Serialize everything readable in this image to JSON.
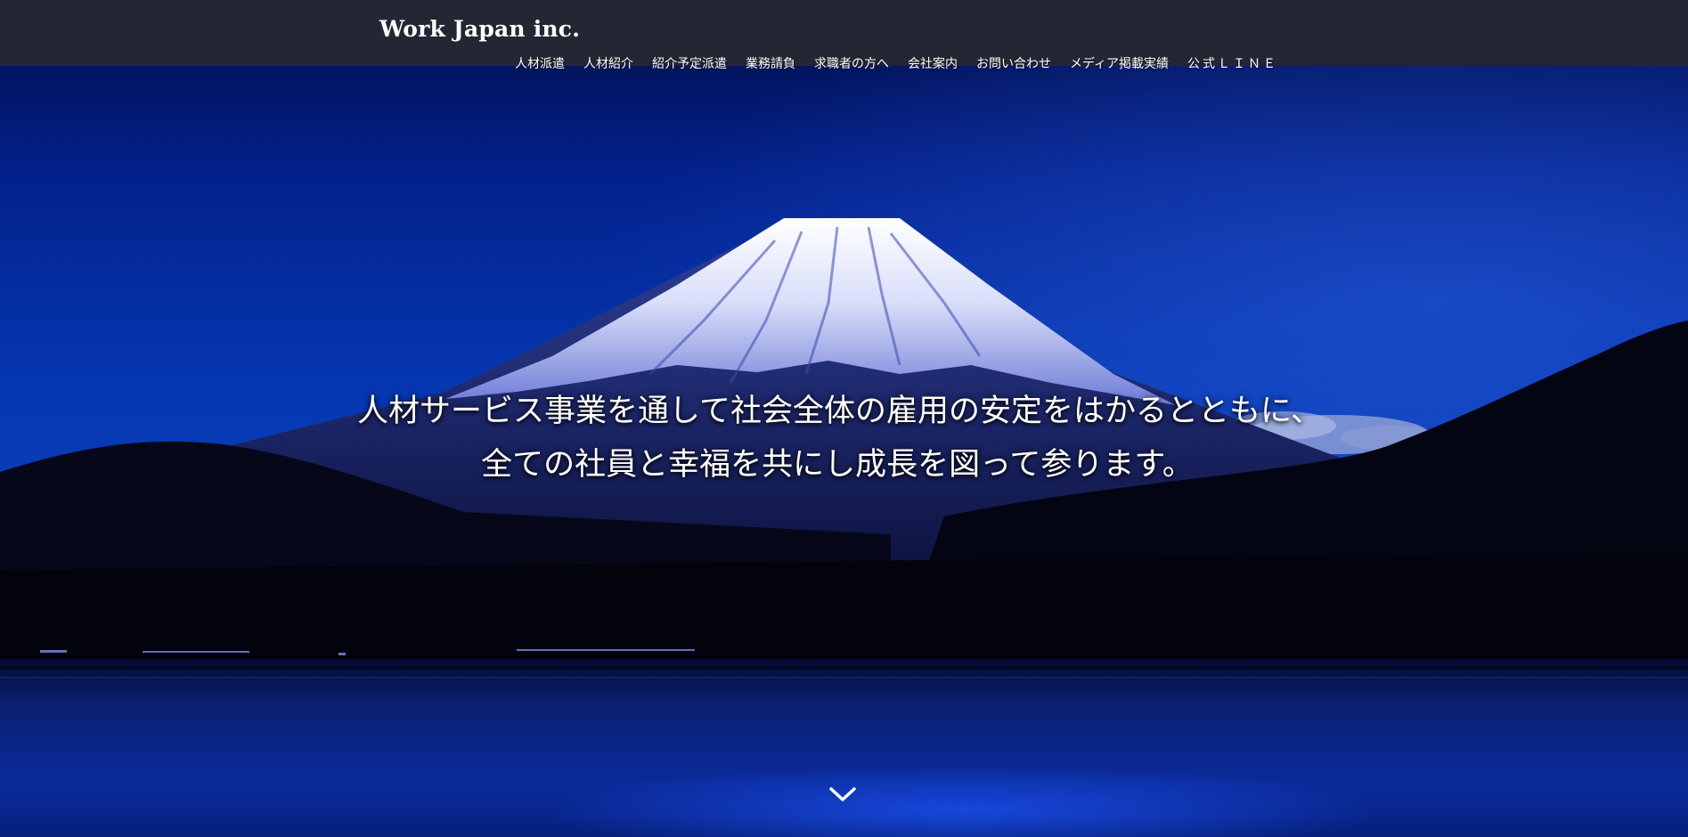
{
  "header": {
    "logo": "Work Japan inc."
  },
  "nav": {
    "items": [
      {
        "label": "人材派遣"
      },
      {
        "label": "人材紹介"
      },
      {
        "label": "紹介予定派遣"
      },
      {
        "label": "業務請負"
      },
      {
        "label": "求職者の方へ"
      },
      {
        "label": "会社案内"
      },
      {
        "label": "お問い合わせ"
      },
      {
        "label": "メディア掲載実績"
      },
      {
        "label": "公式ＬＩＮＥ"
      }
    ]
  },
  "hero": {
    "tagline_line1": "人材サービス事業を通して社会全体の雇用の安定をはかるとともに、",
    "tagline_line2": "全ての社員と幸福を共にし成長を図って参ります。",
    "scroll_icon": "chevron-down-icon"
  },
  "colors": {
    "header_bg": "#222733",
    "sky_top": "#02114f",
    "sky_mid": "#0634a8",
    "lake": "#0a2a9a",
    "text": "#ffffff"
  }
}
